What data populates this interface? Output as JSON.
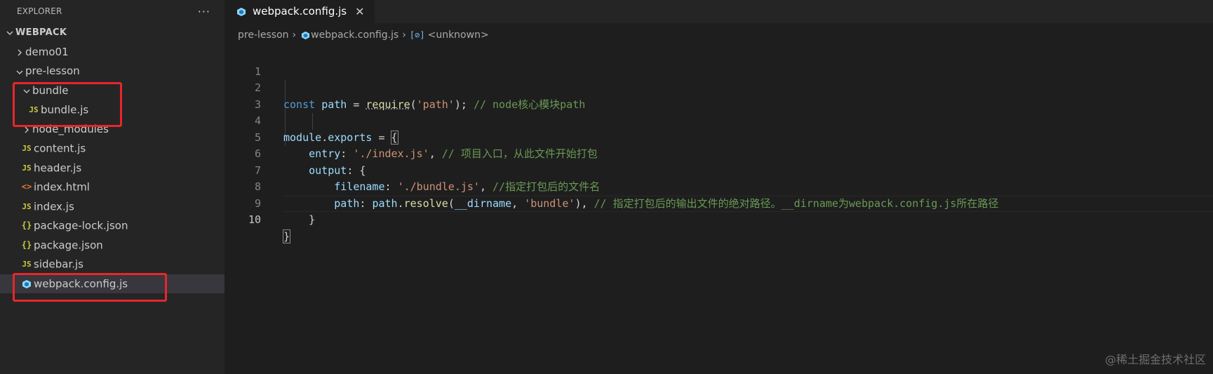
{
  "sidebar": {
    "title": "EXPLORER",
    "more_label": "···",
    "root_label": "WEBPACK",
    "tree": {
      "demo01": "demo01",
      "pre_lesson": "pre-lesson",
      "bundle": "bundle",
      "bundle_js": "bundle.js",
      "node_modules": "node_modules",
      "content_js": "content.js",
      "header_js": "header.js",
      "index_html": "index.html",
      "index_js": "index.js",
      "package_lock_json": "package-lock.json",
      "package_json": "package.json",
      "sidebar_js": "sidebar.js",
      "webpack_config_js": "webpack.config.js"
    },
    "icons": {
      "js": "JS",
      "json": "{}",
      "html": "<>"
    }
  },
  "tab": {
    "label": "webpack.config.js",
    "close": "✕"
  },
  "breadcrumb": {
    "folder": "pre-lesson",
    "file": "webpack.config.js",
    "symbol_icon": "[⊘]",
    "symbol": "<unknown>"
  },
  "code": {
    "line_numbers": [
      "1",
      "2",
      "3",
      "4",
      "5",
      "6",
      "7",
      "8",
      "9",
      "10"
    ],
    "l2": {
      "kw": "const",
      "var": "path",
      "eq": " = ",
      "fn": "require",
      "open": "(",
      "str": "'path'",
      "close": ");",
      "comment": "// node核心模块path"
    },
    "l4": {
      "obj": "module",
      "dot": ".",
      "prop": "exports",
      "eq": " = ",
      "brace": "{"
    },
    "l5": {
      "key": "entry",
      "colon": ": ",
      "str": "'./index.js'",
      "comma": ",",
      "comment": "// 项目入口，从此文件开始打包"
    },
    "l6": {
      "key": "output",
      "rest": ": {"
    },
    "l7": {
      "key": "filename",
      "colon": ": ",
      "str": "'./bundle.js'",
      "comma": ",",
      "comment": "//指定打包后的文件名"
    },
    "l8": {
      "key": "path",
      "colon": ": ",
      "obj": "path",
      "dot": ".",
      "fn": "resolve",
      "open": "(",
      "arg1": "__dirname",
      "comma1": ", ",
      "str": "'bundle'",
      "close": "),",
      "comment": "// 指定打包后的输出文件的绝对路径。__dirname为webpack.config.js所在路径"
    },
    "l9": {
      "brace": "}"
    },
    "l10": {
      "brace": "}"
    }
  },
  "watermark": "@稀土掘金技术社区",
  "colors": {
    "sidebar_bg": "#252526",
    "editor_bg": "#1e1e1e",
    "highlight_box": "#e8262a",
    "js_icon": "#cbcb41",
    "html_icon": "#e37933",
    "webpack_icon": "#8dd6f9"
  }
}
